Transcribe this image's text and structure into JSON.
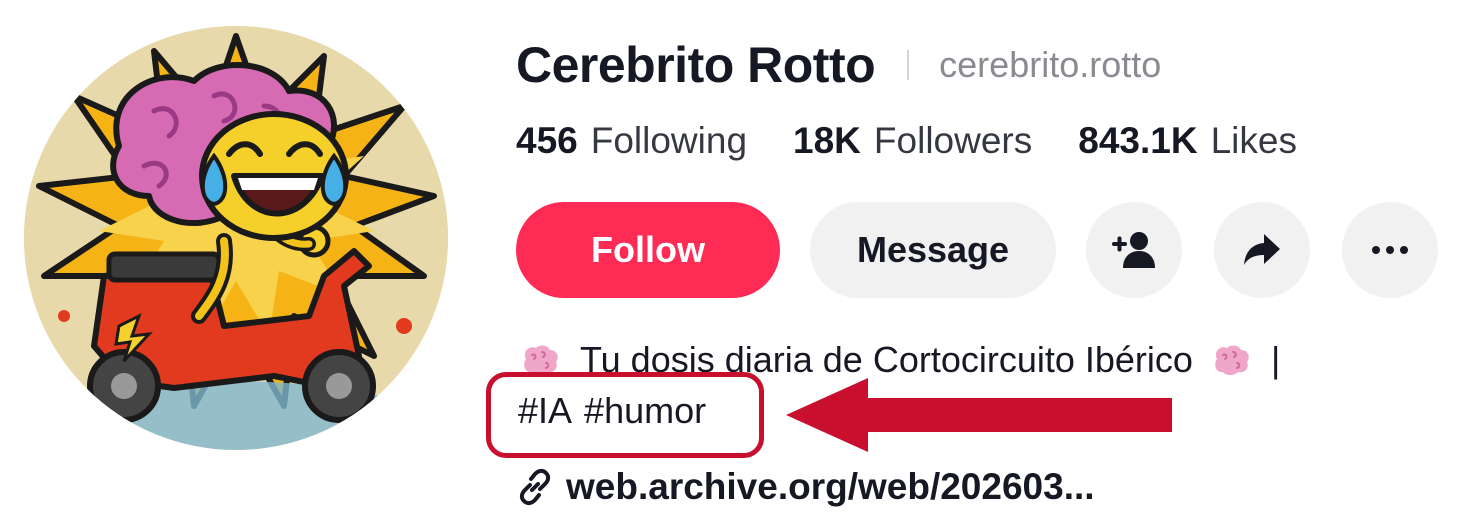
{
  "profile": {
    "display_name": "Cerebrito Rotto",
    "username": "cerebrito.rotto"
  },
  "stats": [
    {
      "value": "456",
      "label": "Following"
    },
    {
      "value": "18K",
      "label": "Followers"
    },
    {
      "value": "843.1K",
      "label": "Likes"
    }
  ],
  "actions": {
    "follow_label": "Follow",
    "message_label": "Message",
    "add_friend_icon": "add-user-icon",
    "share_icon": "share-arrow-icon",
    "more_icon": "ellipsis-icon"
  },
  "bio": {
    "text": "Tu dosis diaria de Cortocircuito Ibérico",
    "separator": "|",
    "emoji": "brain-emoji",
    "hashtags": [
      "#IA",
      "#humor"
    ]
  },
  "link": {
    "text": "web.archive.org/web/202603...",
    "icon": "link-icon"
  },
  "colors": {
    "accent": "#fe2c55",
    "button_bg": "#f1f1f2",
    "text": "#161823",
    "muted": "#8a8b91",
    "annotation": "#c8102e"
  }
}
